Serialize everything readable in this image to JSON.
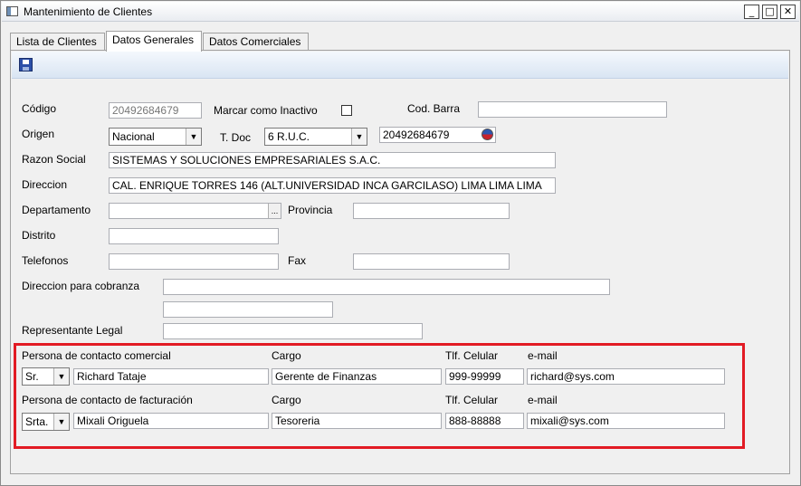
{
  "window": {
    "title": "Mantenimiento de Clientes",
    "buttons": {
      "minimize": "_",
      "maximize": "□",
      "close": "✕"
    }
  },
  "tabs": [
    "Lista de Clientes",
    "Datos Generales",
    "Datos Comerciales"
  ],
  "active_tab": "Datos Generales",
  "toolbar": {
    "save_icon": "save-icon"
  },
  "form": {
    "codigo_label": "Código",
    "codigo_value": "20492684679",
    "inactivo_label": "Marcar como Inactivo",
    "inactivo_checked": false,
    "codbarra_label": "Cod. Barra",
    "codbarra_value": "",
    "origen_label": "Origen",
    "origen_value": "Nacional",
    "tdoc_label": "T. Doc",
    "tdoc_value": "6 R.U.C.",
    "doc_number": "20492684679",
    "razon_label": "Razon Social",
    "razon_value": "SISTEMAS Y SOLUCIONES EMPRESARIALES S.A.C.",
    "direccion_label": "Direccion",
    "direccion_value": "CAL. ENRIQUE TORRES 146  (ALT.UNIVERSIDAD INCA GARCILASO) LIMA LIMA LIMA",
    "departamento_label": "Departamento",
    "departamento_value": "",
    "browse_label": "...",
    "provincia_label": "Provincia",
    "provincia_value": "",
    "distrito_label": "Distrito",
    "distrito_value": "",
    "telefonos_label": "Telefonos",
    "telefonos_value": "",
    "fax_label": "Fax",
    "fax_value": "",
    "cobranza_label": "Direccion para cobranza",
    "cobranza_value_1": "",
    "cobranza_value_2": "",
    "representante_label": "Representante Legal",
    "representante_value": ""
  },
  "contacts": {
    "comercial": {
      "header": "Persona de contacto comercial",
      "cargo_header": "Cargo",
      "celular_header": "Tlf. Celular",
      "email_header": "e-mail",
      "title": "Sr.",
      "name": "Richard Tataje",
      "cargo": "Gerente de Finanzas",
      "celular": "999-99999",
      "email": "richard@sys.com"
    },
    "facturacion": {
      "header": "Persona de contacto de facturación",
      "cargo_header": "Cargo",
      "celular_header": "Tlf. Celular",
      "email_header": "e-mail",
      "title": "Srta.",
      "name": "Mixali Origuela",
      "cargo": "Tesoreria",
      "celular": "888-88888",
      "email": "mixali@sys.com"
    }
  },
  "highlight_color": "#e21b24"
}
